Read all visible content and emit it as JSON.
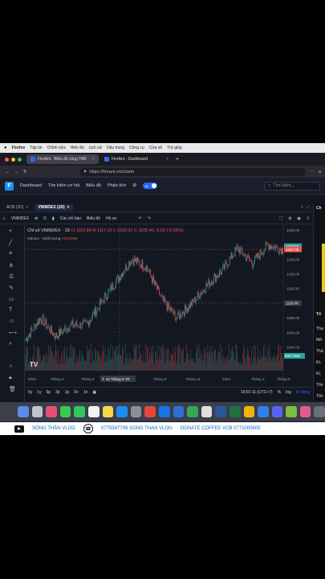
{
  "menubar": {
    "app": "Firefox",
    "items": [
      "Tập tin",
      "Chỉnh sửa",
      "Hiển thị",
      "Lịch sử",
      "Dấu trang",
      "Công cụ",
      "Cửa sổ",
      "Trợ giúp"
    ]
  },
  "browser": {
    "tabs": [
      {
        "label": "FireAnt - Biểu đồ cộng TAB",
        "active": true
      },
      {
        "label": "FireAnt - Dashboard",
        "active": false
      }
    ],
    "url": "https://fireant.vn/charts"
  },
  "appnav": {
    "items": [
      "Dashboard",
      "Tìm kiếm cơ hội",
      "Biểu đồ",
      "Phân tích"
    ],
    "toggle": "18",
    "search_placeholder": "Tìm kiếm..."
  },
  "chart_tabs": [
    {
      "label": "ACB (1D)",
      "active": false
    },
    {
      "label": "VNINDEX (1D)",
      "active": true
    }
  ],
  "toolbar": {
    "symbol": "VNINDEX",
    "interval": "D",
    "indicators": "Các chỉ báo",
    "chart_type": "Biểu đồ",
    "profile": "Hồ sơ"
  },
  "legend": {
    "title": "Chỉ số VNINDEX · 1D",
    "ohlc": "O 1115.89  H 1117.23  L 1102.01  C 1105.40  -5.92 (-0.53%)",
    "volume_label": "Volume · Khối lượng",
    "volume_value": "723.816M"
  },
  "price_axis": {
    "labels": [
      "1320.00",
      "1280.00",
      "1240.00",
      "1200.00",
      "1160.00",
      "1120.00",
      "1080.00",
      "1040.00",
      "1000.00"
    ],
    "last_price": "1267.00",
    "prev_label": "1275.50",
    "cursor_price": "1120.00",
    "volume_tag": "698.705M"
  },
  "time_axis": {
    "labels": [
      "2023",
      "Tháng 3",
      "Tháng 5",
      "T. 19 Tháng 6 '23",
      "Tháng 9",
      "Tháng 11",
      "2024",
      "Tháng 3",
      "Tháng 5"
    ]
  },
  "bottom": {
    "ranges": [
      "5y",
      "1y",
      "6p",
      "3p",
      "1p",
      "5n",
      "1n"
    ],
    "time": "19:01:11 (UTC+7)",
    "pct": "%",
    "log": "log",
    "auto": "tự động"
  },
  "rightpanel": {
    "items": [
      "Ch",
      "Tổ",
      "Tha",
      "Mở",
      "Thấ",
      "KL",
      "KL",
      "Tổn",
      "Tổn"
    ]
  },
  "colors": {
    "up": "#26a69a",
    "down": "#ef5350",
    "bg": "#131722",
    "accent": "#2962ff"
  },
  "video_bar": {
    "channel": "SÓNG THẦN VLOG",
    "contact": "0775587799 SONG THAN VLOG",
    "donate": "DONATE COFFEE  VCB 0771000605"
  },
  "chart_data": {
    "type": "candlestick",
    "title": "Chỉ số VNINDEX · 1D",
    "x_range": [
      "2023-01",
      "2024-06"
    ],
    "ylim": [
      990,
      1320
    ],
    "close_path": [
      {
        "x": "2023-01",
        "y": 1020
      },
      {
        "x": "2023-02",
        "y": 1080
      },
      {
        "x": "2023-03",
        "y": 1030
      },
      {
        "x": "2023-04",
        "y": 1060
      },
      {
        "x": "2023-05",
        "y": 1060
      },
      {
        "x": "2023-06",
        "y": 1120
      },
      {
        "x": "2023-07",
        "y": 1180
      },
      {
        "x": "2023-08",
        "y": 1240
      },
      {
        "x": "2023-09",
        "y": 1220
      },
      {
        "x": "2023-10",
        "y": 1130
      },
      {
        "x": "2023-11",
        "y": 1080
      },
      {
        "x": "2023-12",
        "y": 1120
      },
      {
        "x": "2024-01",
        "y": 1170
      },
      {
        "x": "2024-02",
        "y": 1210
      },
      {
        "x": "2024-03",
        "y": 1270
      },
      {
        "x": "2024-04",
        "y": 1230
      },
      {
        "x": "2024-05",
        "y": 1280
      },
      {
        "x": "2024-06",
        "y": 1267
      }
    ]
  }
}
